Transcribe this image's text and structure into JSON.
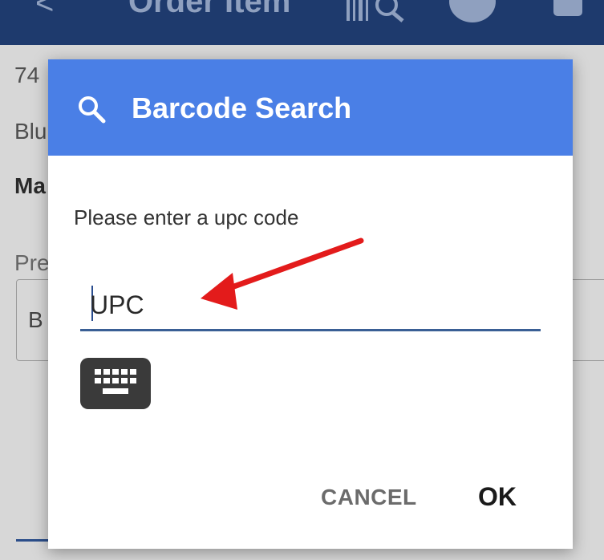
{
  "app": {
    "back_glyph": "<",
    "title": "Order Item",
    "icons": [
      "chevron-left-icon",
      "barcode-scan-icon",
      "user-icon",
      "cart-icon"
    ],
    "colors": {
      "app_bar": "#1e3a6d"
    }
  },
  "background": {
    "sku": "74",
    "description": "Blu",
    "section": "Ma",
    "price_label": "Pre",
    "select_value": "B"
  },
  "dialog": {
    "title": "Barcode Search",
    "title_icon": "search-icon",
    "message": "Please enter a upc code",
    "input": {
      "value": "",
      "placeholder": "UPC"
    },
    "keyboard_icon": "keyboard-icon",
    "cancel_label": "CANCEL",
    "ok_label": "OK",
    "colors": {
      "header": "#4a7fe6",
      "field_underline": "#3a5f95"
    }
  },
  "annotation": {
    "type": "arrow",
    "color": "#e31b1b",
    "points_to": "upc-input"
  }
}
